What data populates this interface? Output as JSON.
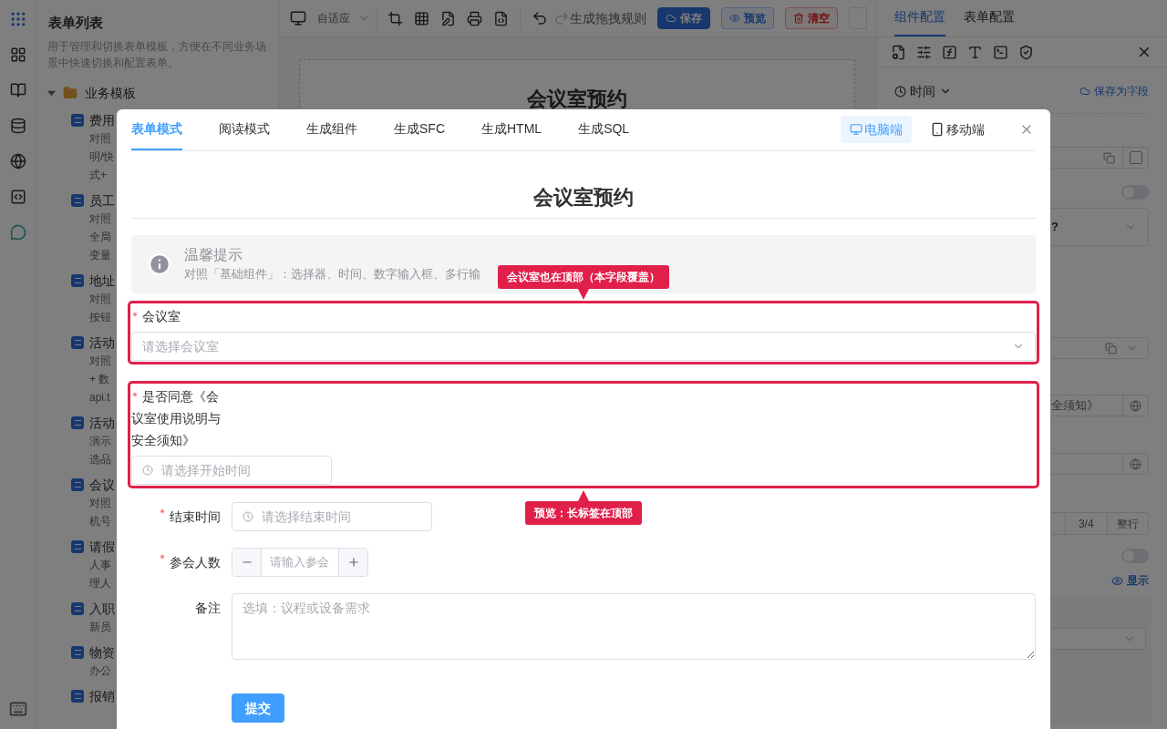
{
  "sidebar": {
    "title": "表单列表",
    "description": "用于管理和切换表单模板，方便在不同业务场景中快速切换和配置表单。",
    "folder": {
      "label": "业务模板",
      "expanded": true,
      "children": [
        {
          "title": "费用",
          "lines": [
            "对照",
            "明/快",
            "式+"
          ]
        },
        {
          "title": "员工",
          "lines": [
            "对照",
            "全局",
            "变量"
          ]
        },
        {
          "title": "地址",
          "lines": [
            "对照",
            "按钮"
          ]
        },
        {
          "title": "活动",
          "lines": [
            "对照",
            "+ 数",
            "api.t"
          ]
        },
        {
          "title": "活动",
          "lines": [
            "演示",
            "选品"
          ]
        },
        {
          "title": "会议",
          "lines": [
            "对照",
            "机号"
          ]
        },
        {
          "title": "请假",
          "lines": [
            "人事",
            "理人"
          ]
        },
        {
          "title": "入职",
          "lines": [
            "新员"
          ]
        },
        {
          "title": "物资",
          "lines": [
            "办公"
          ]
        },
        {
          "title": "报销"
        }
      ]
    }
  },
  "toolbar": {
    "viewport": "自适应",
    "rule_button": "生成拖拽规则",
    "buttons": [
      {
        "label": "保存",
        "kind": "primary"
      },
      {
        "label": "预览",
        "kind": "outline"
      },
      {
        "label": "清空",
        "kind": "danger"
      }
    ]
  },
  "canvas": {
    "title": "会议室预约"
  },
  "config_panel": {
    "tabs": [
      {
        "label": "组件配置",
        "selected": true
      },
      {
        "label": "表单配置",
        "selected": false
      }
    ],
    "field_type": "时间",
    "save_field": "保存为字段",
    "select_fragment": "?",
    "input_fragment": "全须知》",
    "toggles": [
      {
        "on": false
      },
      {
        "on": false
      }
    ],
    "width_options": [
      {
        "label": "3/4",
        "selected": false
      },
      {
        "label": "整行",
        "selected": false
      }
    ],
    "visibility": "显示"
  },
  "modal": {
    "tabs": [
      {
        "label": "表单模式",
        "selected": true
      },
      {
        "label": "阅读模式",
        "selected": false
      },
      {
        "label": "生成组件",
        "selected": false
      },
      {
        "label": "生成SFC",
        "selected": false
      },
      {
        "label": "生成HTML",
        "selected": false
      },
      {
        "label": "生成SQL",
        "selected": false
      }
    ],
    "devices": [
      {
        "label": "电脑端",
        "kind": "desktop",
        "selected": true
      },
      {
        "label": "移动端",
        "kind": "mobile",
        "selected": false
      }
    ],
    "title": "会议室预约",
    "alert": {
      "title": "温馨提示",
      "text": "对照「基础组件」：选择器、时间、数字输入框、多行输"
    },
    "fields": [
      {
        "kind": "select",
        "label": "会议室",
        "required": true,
        "highlighted": true,
        "placeholder": "请选择会议室",
        "callout_above": "会议室也在顶部（本字段覆盖）"
      },
      {
        "kind": "time",
        "label": "是否同意《会议室使用说明与安全须知》",
        "required": true,
        "highlighted": true,
        "placeholder": "请选择开始时间",
        "callout_below": "预览：长标签在顶部"
      },
      {
        "kind": "time",
        "label": "结束时间",
        "required": true,
        "highlighted": false,
        "placeholder": "请选择结束时间"
      },
      {
        "kind": "number",
        "label": "参会人数",
        "required": true,
        "highlighted": false,
        "placeholder": "请输入参会"
      },
      {
        "kind": "textarea",
        "label": "备注",
        "required": false,
        "highlighted": false,
        "placeholder": "选填：议程或设备需求"
      }
    ],
    "submit": "提交"
  }
}
